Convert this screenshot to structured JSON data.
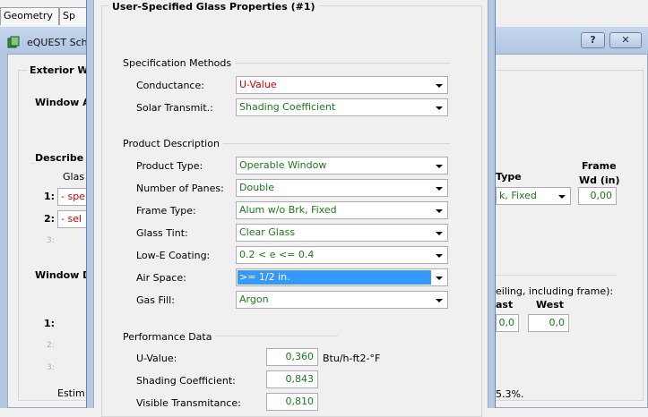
{
  "top_tabs": [
    "Geometry",
    "Sp"
  ],
  "back_window": {
    "title": "eQUEST Sch",
    "help_btn": "?",
    "close_btn": "✕",
    "group_title": "Exterior W",
    "window_a_label": "Window A",
    "describe_label": "Describe",
    "glass_header": "Glas",
    "row1_num": "1:",
    "row1_val": "- spe",
    "row2_num": "2:",
    "row2_val": "- sel",
    "row3_num": "3:",
    "window_d_label": "Window D",
    "wd_row1_num": "1:",
    "wd_row2_num": "2:",
    "wd_row3_num": "3:",
    "frame_type_header": "Type",
    "frame_type_value": "k, Fixed",
    "frame_wd_header1": "Frame",
    "frame_wd_header2": "Wd (in)",
    "frame_wd_value": "0,00",
    "ceiling_text": "eiling, including frame):",
    "east_label": "ast",
    "west_label": "West",
    "east_value": "0,0",
    "west_value": "0,0",
    "estimate_label": "Estim",
    "percent_text": "5.3%."
  },
  "dialog": {
    "title": "User-Specified Glass Properties (#1)",
    "spec_section": "Specification Methods",
    "conductance_label": "Conductance:",
    "conductance_value": "U-Value",
    "solar_label": "Solar Transmit.:",
    "solar_value": "Shading Coefficient",
    "product_section": "Product Description",
    "product_type_label": "Product Type:",
    "product_type_value": "Operable Window",
    "panes_label": "Number of Panes:",
    "panes_value": "Double",
    "frame_type_label": "Frame Type:",
    "frame_type_value": "Alum w/o Brk, Fixed",
    "glass_tint_label": "Glass Tint:",
    "glass_tint_value": "Clear Glass",
    "lowe_label": "Low-E Coating:",
    "lowe_value": "0.2 < e <= 0.4",
    "air_space_label": "Air Space:",
    "air_space_value": ">= 1/2 in.",
    "gas_fill_label": "Gas Fill:",
    "gas_fill_value": "Argon",
    "perf_section": "Performance Data",
    "uvalue_label": "U-Value:",
    "uvalue_value": "0,360",
    "uvalue_unit": "Btu/h-ft2-°F",
    "sc_label": "Shading Coefficient:",
    "sc_value": "0,843",
    "vt_label": "Visible Transmitance:",
    "vt_value": "0,810"
  },
  "colors": {
    "value_text": "#1a7a1a",
    "warning_text": "#cc0000",
    "selection": "#3399ff",
    "frame": "#b3c9e3"
  }
}
